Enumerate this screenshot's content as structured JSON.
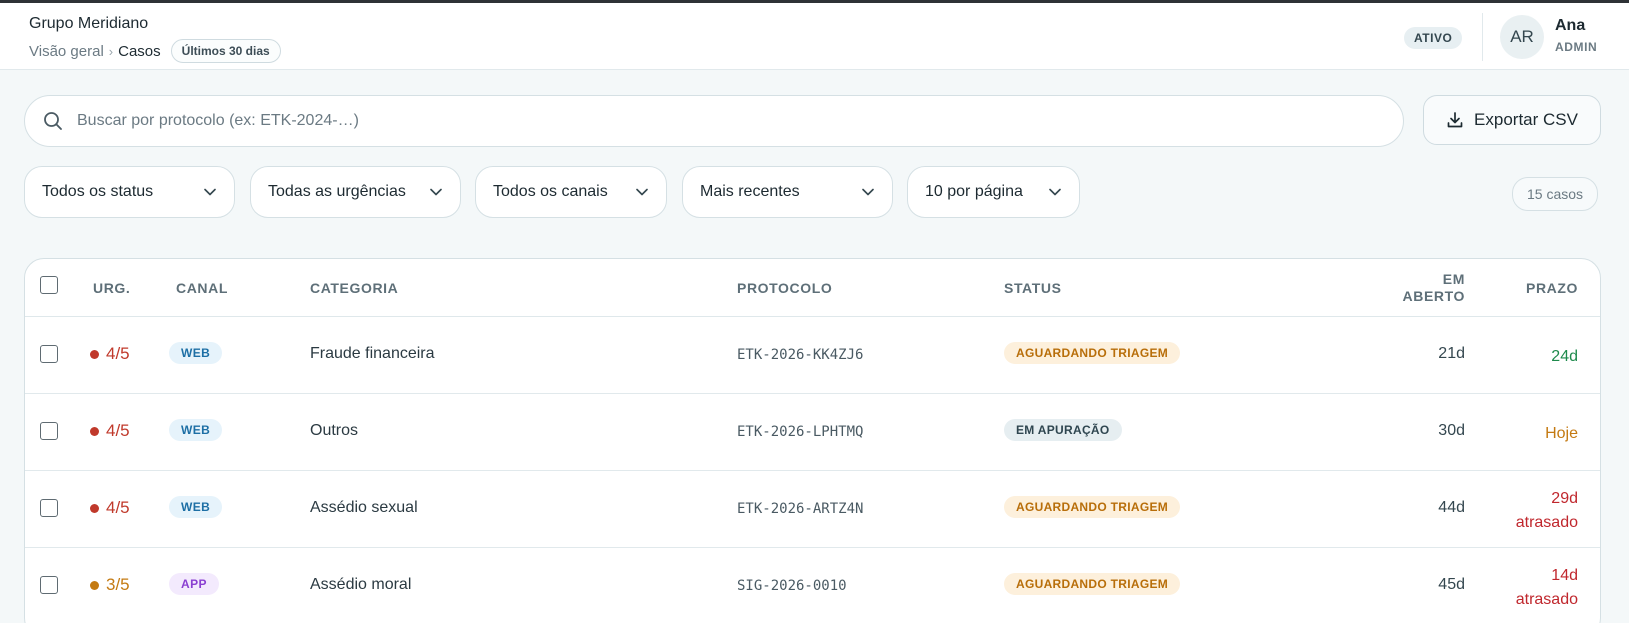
{
  "header": {
    "org_name": "Grupo Meridiano",
    "breadcrumb": {
      "parent": "Visão geral",
      "separator": "›",
      "current": "Casos"
    },
    "period_chip": "Últimos 30 dias",
    "status_pill": "ATIVO",
    "user": {
      "initials": "AR",
      "name": "Ana",
      "role": "ADMIN"
    }
  },
  "search": {
    "placeholder": "Buscar por protocolo (ex: ETK-2024-…)",
    "value": "",
    "icon": "search-icon"
  },
  "export_button": {
    "label": "Exportar CSV",
    "icon": "download-icon"
  },
  "filters": [
    {
      "label": "Todos os status"
    },
    {
      "label": "Todas as urgências"
    },
    {
      "label": "Todos os canais"
    },
    {
      "label": "Mais recentes"
    },
    {
      "label": "10 por página"
    }
  ],
  "case_count": "15 casos",
  "table": {
    "headers": {
      "urgency": "URG.",
      "channel": "CANAL",
      "category": "CATEGORIA",
      "protocol": "PROTOCOLO",
      "status": "STATUS",
      "open_line1": "EM",
      "open_line2": "ABERTO",
      "deadline": "PRAZO"
    },
    "rows": [
      {
        "urgency": "4/5",
        "urgency_color": "#c0392b",
        "channel": "WEB",
        "channel_fg": "#1d6fa5",
        "channel_bg": "#e6f3fb",
        "category": "Fraude financeira",
        "protocol": "ETK-2026-KK4ZJ6",
        "status": "AGUARDANDO TRIAGEM",
        "status_fg": "#b86e0a",
        "status_bg": "#fdf0dc",
        "open": "21d",
        "deadline_line1": "24d",
        "deadline_line2": "",
        "deadline_color": "#1e8a4c"
      },
      {
        "urgency": "4/5",
        "urgency_color": "#c0392b",
        "channel": "WEB",
        "channel_fg": "#1d6fa5",
        "channel_bg": "#e6f3fb",
        "category": "Outros",
        "protocol": "ETK-2026-LPHTMQ",
        "status": "EM APURAÇÃO",
        "status_fg": "#2f4650",
        "status_bg": "#e6eef1",
        "open": "30d",
        "deadline_line1": "Hoje",
        "deadline_line2": "",
        "deadline_color": "#c47a12"
      },
      {
        "urgency": "4/5",
        "urgency_color": "#c0392b",
        "channel": "WEB",
        "channel_fg": "#1d6fa5",
        "channel_bg": "#e6f3fb",
        "category": "Assédio sexual",
        "protocol": "ETK-2026-ARTZ4N",
        "status": "AGUARDANDO TRIAGEM",
        "status_fg": "#b86e0a",
        "status_bg": "#fdf0dc",
        "open": "44d",
        "deadline_line1": "29d",
        "deadline_line2": "atrasado",
        "deadline_color": "#c0272d"
      },
      {
        "urgency": "3/5",
        "urgency_color": "#c47a12",
        "channel": "APP",
        "channel_fg": "#8a3fd1",
        "channel_bg": "#f3eafd",
        "category": "Assédio moral",
        "protocol": "SIG-2026-0010",
        "status": "AGUARDANDO TRIAGEM",
        "status_fg": "#b86e0a",
        "status_bg": "#fdf0dc",
        "open": "45d",
        "deadline_line1": "14d",
        "deadline_line2": "atrasado",
        "deadline_color": "#c0272d"
      }
    ]
  }
}
